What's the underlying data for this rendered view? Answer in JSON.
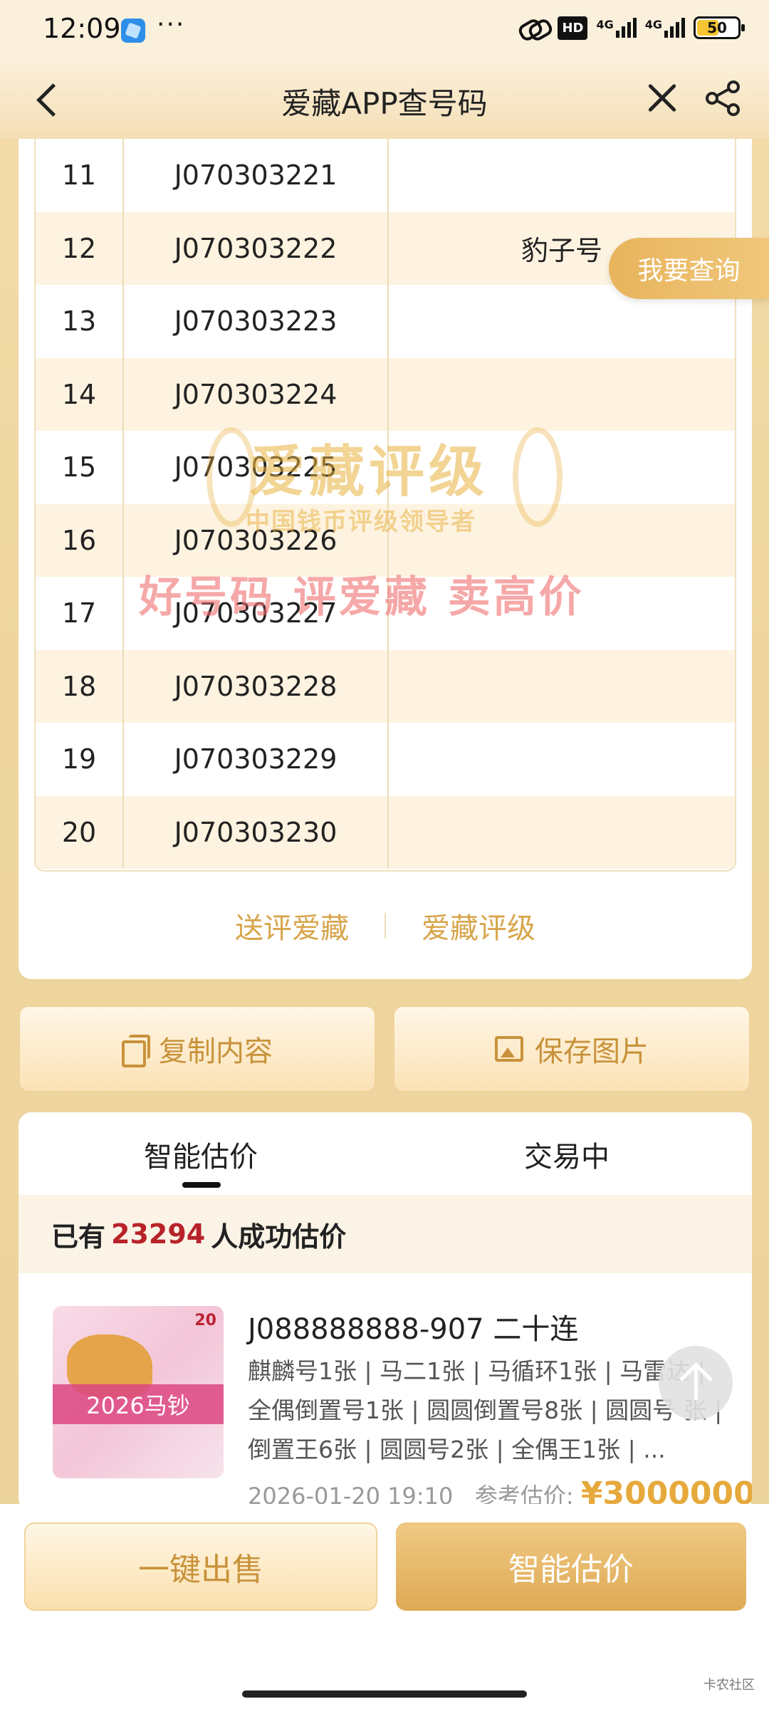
{
  "status_bar": {
    "time": "12:09",
    "dots": "···",
    "hd": "HD",
    "net1": "4G",
    "net2": "4G",
    "battery": "50"
  },
  "nav": {
    "title": "爱藏APP查号码"
  },
  "table": {
    "rows": [
      {
        "idx": "11",
        "code": "J070303221",
        "tag": ""
      },
      {
        "idx": "12",
        "code": "J070303222",
        "tag": "豹子号"
      },
      {
        "idx": "13",
        "code": "J070303223",
        "tag": ""
      },
      {
        "idx": "14",
        "code": "J070303224",
        "tag": ""
      },
      {
        "idx": "15",
        "code": "J070303225",
        "tag": ""
      },
      {
        "idx": "16",
        "code": "J070303226",
        "tag": ""
      },
      {
        "idx": "17",
        "code": "J070303227",
        "tag": ""
      },
      {
        "idx": "18",
        "code": "J070303228",
        "tag": ""
      },
      {
        "idx": "19",
        "code": "J070303229",
        "tag": ""
      },
      {
        "idx": "20",
        "code": "J070303230",
        "tag": ""
      }
    ]
  },
  "watermark": {
    "title": "爱藏评级",
    "subtitle": "中国钱币评级领导者",
    "slogan": "好号码 评爱藏 卖高价"
  },
  "query_float": "我要查询",
  "links": {
    "left": "送评爱藏",
    "right": "爱藏评级"
  },
  "actions": {
    "copy": "复制内容",
    "save": "保存图片"
  },
  "estimate": {
    "tab_estimate": "智能估价",
    "tab_trading": "交易中",
    "stat_prefix": "已有",
    "stat_count": "23294",
    "stat_suffix": "人成功估价",
    "item": {
      "thumb_label": "2026马钞",
      "thumb_value": "20",
      "title": "J088888888-907 二十连",
      "tags": "麒麟号1张 | 马二1张 | 马循环1张 | 马雷达 | 全偶倒置号1张 | 圆圆倒置号8张 | 圆圆号 张 | 倒置王6张 | 圆圆号2张 | 全偶王1张 | ...",
      "date": "2026-01-20 19:10",
      "ref_label": "参考估价:",
      "price": "¥3000000"
    }
  },
  "bottom": {
    "sell": "一键出售",
    "estimate": "智能估价",
    "site_mark": "卡农社区"
  },
  "colors": {
    "accent_gold": "#d8a54c",
    "highlight_red": "#b8232a",
    "price_gold": "#e6a93b"
  }
}
